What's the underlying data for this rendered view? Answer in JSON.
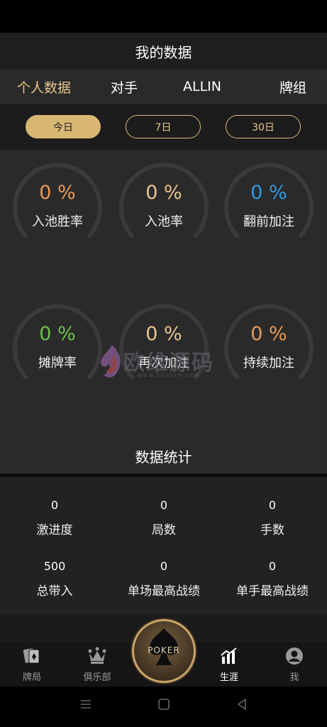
{
  "header": {
    "title": "我的数据"
  },
  "top_tabs": [
    {
      "label": "个人数据",
      "active": true
    },
    {
      "label": "对手",
      "active": false
    },
    {
      "label": "ALLIN",
      "active": false
    },
    {
      "label": "牌组",
      "active": false
    }
  ],
  "periods": [
    {
      "label": "今日",
      "active": true
    },
    {
      "label": "7日",
      "active": false
    },
    {
      "label": "30日",
      "active": false
    }
  ],
  "gauges": [
    {
      "value": "0 %",
      "label": "入池胜率",
      "color": "#e89a5a"
    },
    {
      "value": "0 %",
      "label": "入池率",
      "color": "#e8c58a"
    },
    {
      "value": "0 %",
      "label": "翻前加注",
      "color": "#2f9be6"
    },
    {
      "value": "0 %",
      "label": "摊牌率",
      "color": "#6cc24a"
    },
    {
      "value": "0 %",
      "label": "再次加注",
      "color": "#e8c58a"
    },
    {
      "value": "0 %",
      "label": "持续加注",
      "color": "#e89a5a"
    }
  ],
  "summary": {
    "title": "数据统计",
    "cells": [
      {
        "value": "0",
        "label": "激进度"
      },
      {
        "value": "0",
        "label": "局数"
      },
      {
        "value": "0",
        "label": "手数"
      },
      {
        "value": "500",
        "label": "总带入"
      },
      {
        "value": "0",
        "label": "单场最高战绩"
      },
      {
        "value": "0",
        "label": "单手最高战绩"
      }
    ]
  },
  "nav": {
    "items": [
      {
        "label": "牌局",
        "icon": "cards-icon",
        "active": false
      },
      {
        "label": "俱乐部",
        "icon": "crown-icon",
        "active": false
      },
      {
        "label": "生涯",
        "icon": "chart-icon",
        "active": true
      },
      {
        "label": "我",
        "icon": "user-icon",
        "active": false
      }
    ],
    "center_label": "POKER"
  },
  "watermark": {
    "main": "欧维源码",
    "sub": "WWW.OULUYM.COM"
  },
  "colors": {
    "gold": "#e5c589",
    "gauge_track": "#3a3a3a",
    "background": "#2a2a2a"
  }
}
